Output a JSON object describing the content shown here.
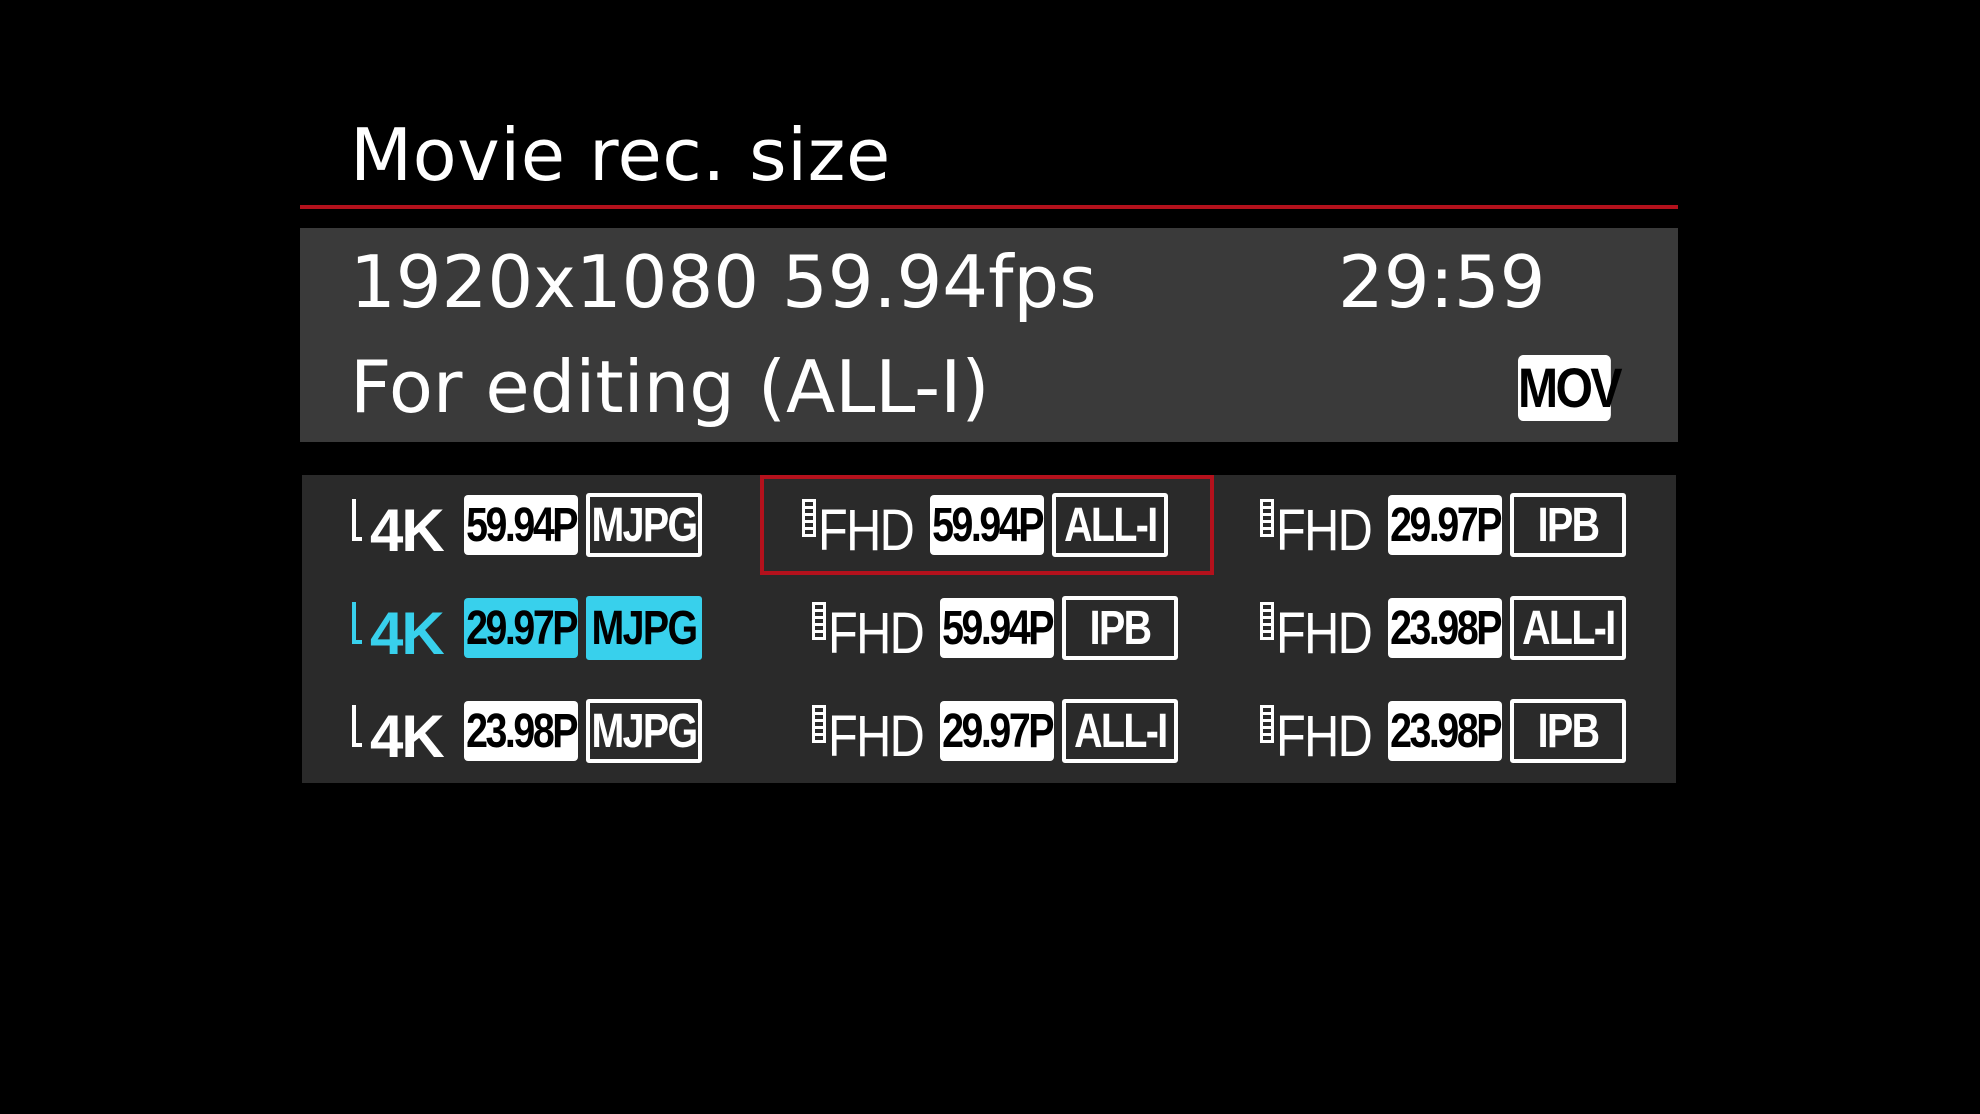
{
  "screen": {
    "title": "Movie rec. size"
  },
  "info": {
    "resolution_fps": "1920x1080 59.94fps",
    "remaining_time": "29:59",
    "compression": "For editing (ALL-I)",
    "file_format": "MOV"
  },
  "options": [
    {
      "id": "4k-5994-mjpg",
      "resolution": "4K",
      "fps": "59.94P",
      "codec": "MJPG",
      "state": "normal"
    },
    {
      "id": "fhd-5994-alli",
      "resolution": "FHD",
      "fps": "59.94P",
      "codec": "ALL-I",
      "state": "selected"
    },
    {
      "id": "fhd-2997-ipb",
      "resolution": "FHD",
      "fps": "29.97P",
      "codec": "IPB",
      "state": "normal"
    },
    {
      "id": "4k-2997-mjpg",
      "resolution": "4K",
      "fps": "29.97P",
      "codec": "MJPG",
      "state": "highlighted"
    },
    {
      "id": "fhd-5994-ipb",
      "resolution": "FHD",
      "fps": "59.94P",
      "codec": "IPB",
      "state": "normal"
    },
    {
      "id": "fhd-2398-alli",
      "resolution": "FHD",
      "fps": "23.98P",
      "codec": "ALL-I",
      "state": "normal"
    },
    {
      "id": "4k-2398-mjpg",
      "resolution": "4K",
      "fps": "23.98P",
      "codec": "MJPG",
      "state": "normal"
    },
    {
      "id": "fhd-2997-alli",
      "resolution": "FHD",
      "fps": "29.97P",
      "codec": "ALL-I",
      "state": "normal"
    },
    {
      "id": "fhd-2398-ipb",
      "resolution": "FHD",
      "fps": "23.98P",
      "codec": "IPB",
      "state": "normal"
    }
  ],
  "colors": {
    "accent_red": "#b3111c",
    "highlight_cyan": "#38d0ec",
    "info_panel_bg": "#3a3a3a",
    "grid_panel_bg": "#2a2a2a"
  }
}
